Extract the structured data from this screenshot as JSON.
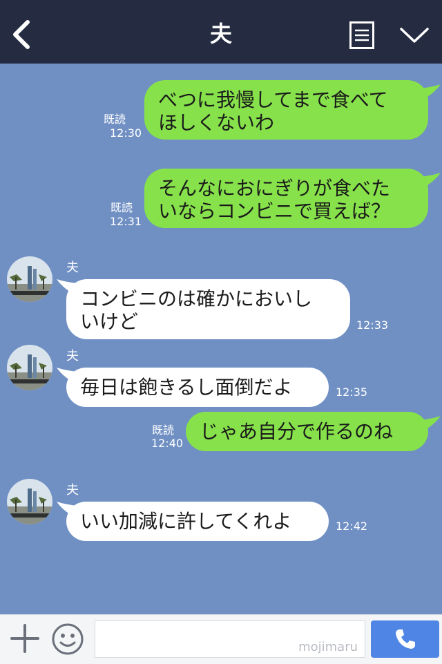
{
  "header": {
    "title": "夫"
  },
  "messages": [
    {
      "text": "べつに我慢してまで食べて\nほしくないわ",
      "read": "既読",
      "time": "12:30"
    },
    {
      "text": "そんなにおにぎりが食べた\nいならコンビニで買えば？",
      "read": "既読",
      "time": "12:31"
    },
    {
      "sender": "夫",
      "text": "コンビニのは確かにおいし\nいけど",
      "time": "12:33"
    },
    {
      "sender": "夫",
      "text": "毎日は飽きるし面倒だよ",
      "time": "12:35"
    },
    {
      "text": "じゃあ自分で作るのね",
      "read": "既読",
      "time": "12:40"
    },
    {
      "sender": "夫",
      "text": "いい加減に許してくれよ",
      "time": "12:42"
    }
  ],
  "footer": {
    "watermark": "mojimaru"
  },
  "colors": {
    "header_bg": "#252c42",
    "chat_bg": "#7090c4",
    "outgoing_bubble": "#86e14b",
    "incoming_bubble": "#ffffff",
    "call_button": "#4f86e6"
  }
}
